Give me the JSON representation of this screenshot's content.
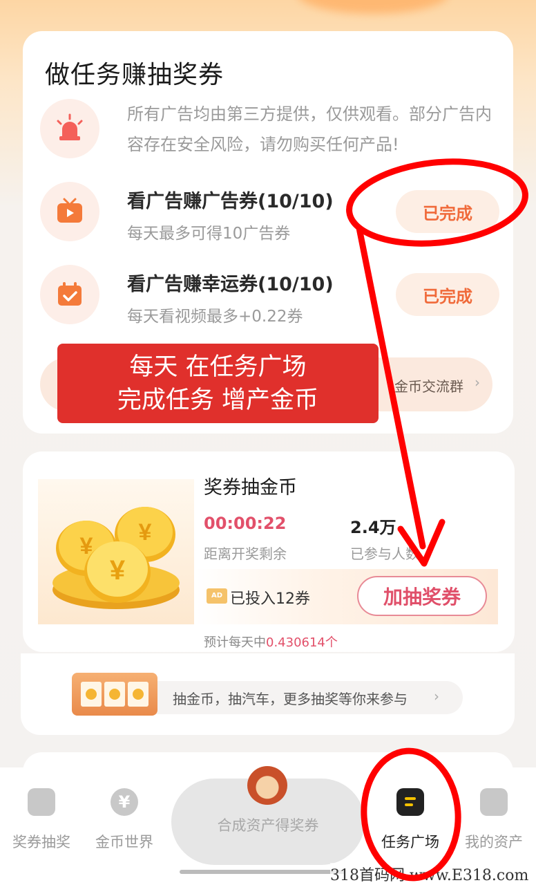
{
  "task_section": {
    "title": "做任务赚抽奖券",
    "notice": "所有广告均由第三方提供，仅供观看。部分广告内容存在安全风险，请勿购买任何产品!",
    "tasks": [
      {
        "title": "看广告赚广告券(10/10)",
        "subtitle": "每天最多可得10广告券",
        "button": "已完成",
        "icon": "tv-play-icon"
      },
      {
        "title": "看广告赚幸运券(10/10)",
        "subtitle": "每天看视频最多+0.22券",
        "button": "已完成",
        "icon": "calendar-check-icon"
      }
    ],
    "group_label": "金币交流群",
    "banner_line1": "每天 在任务广场",
    "banner_line2": "完成任务 增产金币"
  },
  "lottery": {
    "title": "奖券抽金币",
    "countdown": "00:00:22",
    "countdown_label": "距离开奖剩余",
    "participants": "2.4万",
    "participants_label": "已参与人数",
    "invested": "已投入12券",
    "add_button": "加抽奖券",
    "expect_prefix": "预计每天中",
    "expect_value": "0.430614个"
  },
  "promo": {
    "text": "抽金币，抽汽车，更多抽奖等你来参与"
  },
  "nav": {
    "items": [
      "奖券抽奖",
      "金币世界",
      "合成资产得奖券",
      "任务广场",
      "我的资产"
    ],
    "active": "任务广场"
  },
  "watermark": "318首码网 www.E318.com",
  "colors": {
    "accent": "#f06a3a",
    "pink": "#e2506a",
    "banner": "#e0302c",
    "annotation": "#ff0000"
  }
}
